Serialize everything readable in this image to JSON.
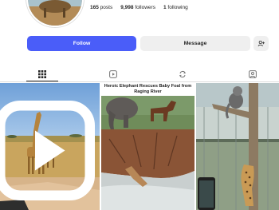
{
  "profile": {
    "posts_count": "165",
    "posts_label": "posts",
    "followers_count": "9,998",
    "followers_label": "followers",
    "following_count": "1",
    "following_label": "following"
  },
  "actions": {
    "follow_label": "Follow",
    "message_label": "Message",
    "add_user_icon": "add-user-icon"
  },
  "tabs": [
    {
      "name": "grid",
      "icon": "grid-icon",
      "active": true
    },
    {
      "name": "reels",
      "icon": "reels-icon",
      "active": false
    },
    {
      "name": "reposts",
      "icon": "repost-icon",
      "active": false
    },
    {
      "name": "tagged",
      "icon": "tagged-icon",
      "active": false
    }
  ],
  "grid": {
    "tile2_caption": "Heroic Elephant Rescues Baby Foal from Raging River"
  },
  "colors": {
    "follow_button": "#4a5df9",
    "secondary_button": "#efefef"
  }
}
